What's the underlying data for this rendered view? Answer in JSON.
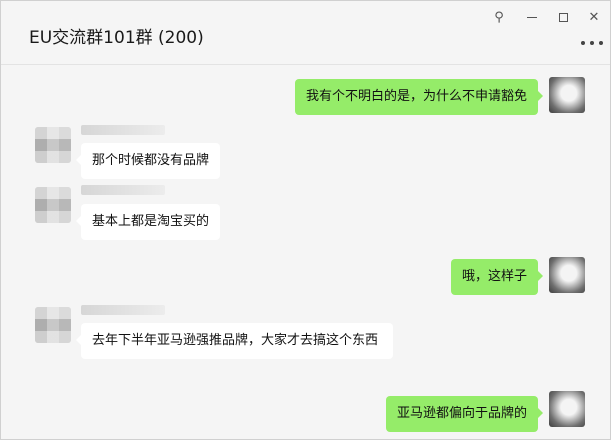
{
  "window": {
    "title": "EU交流群101群 (200)",
    "controls": {
      "pin_icon": "pin-icon",
      "pin_glyph": "⚲",
      "minimize_icon": "minimize-icon",
      "maximize_icon": "maximize-icon",
      "close_icon": "close-icon",
      "close_glyph": "✕",
      "more_icon": "more-icon"
    }
  },
  "colors": {
    "outgoing_bubble": "#95ec69",
    "incoming_bubble": "#ffffff",
    "background": "#f5f5f5"
  },
  "messages": [
    {
      "direction": "out",
      "text": "我有个不明白的是，为什么不申请豁免"
    },
    {
      "direction": "in",
      "text": "那个时候都没有品牌"
    },
    {
      "direction": "in",
      "text": "基本上都是淘宝买的"
    },
    {
      "direction": "out",
      "text": "哦，这样子"
    },
    {
      "direction": "in",
      "text": "去年下半年亚马逊强推品牌，大家才去搞这个东西"
    },
    {
      "direction": "out",
      "text": "亚马逊都偏向于品牌的"
    }
  ]
}
